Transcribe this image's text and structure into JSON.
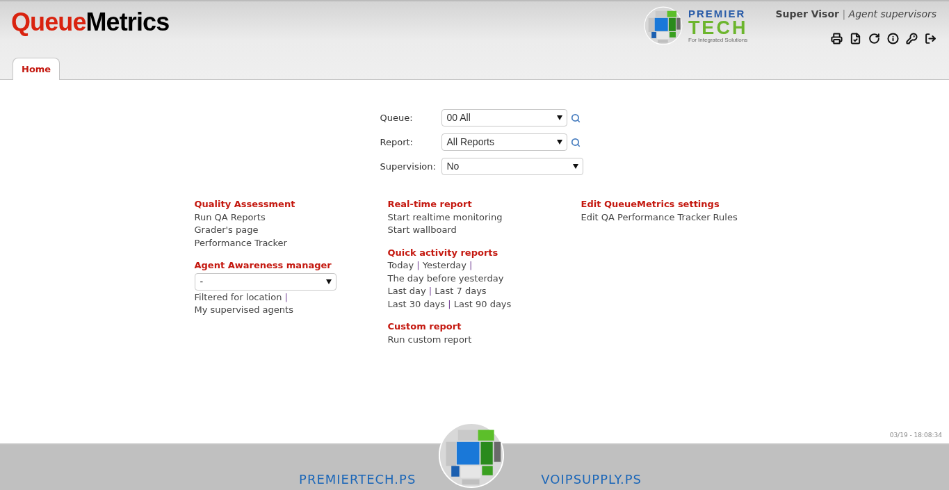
{
  "header": {
    "logo": [
      {
        "text": "Queue",
        "color": "#d9230f"
      },
      {
        "text": "Metrics",
        "color": "#000000"
      }
    ],
    "partner_logo": {
      "line_1": "PREMIER",
      "line_2": "TECH",
      "tagline": "For Integrated Solutions"
    },
    "user": {
      "name": "Super Visor",
      "separator": "|",
      "role": "Agent supervisors"
    },
    "toolbar": [
      {
        "kind": "print"
      },
      {
        "kind": "checklist"
      },
      {
        "kind": "refresh"
      },
      {
        "kind": "info"
      },
      {
        "kind": "key"
      },
      {
        "kind": "logout"
      }
    ]
  },
  "tabs": [
    {
      "label": "Home",
      "selected": true
    }
  ],
  "filters": [
    {
      "label": "Queue:",
      "value": "00 All",
      "search": true
    },
    {
      "label": "Report:",
      "value": "All Reports",
      "search": true
    },
    {
      "label": "Supervision:",
      "value": "No",
      "search": false
    }
  ],
  "separator": "|",
  "columns": [
    {
      "sections": [
        {
          "title": "Quality Assessment",
          "lines": [
            [
              "Run QA Reports"
            ],
            [
              "Grader's page"
            ],
            [
              "Performance Tracker"
            ]
          ]
        },
        {
          "title": "Agent Awareness manager",
          "select": {
            "value": "-"
          },
          "lines": [
            [
              "Filtered for location",
              "My supervised agents"
            ]
          ]
        }
      ]
    },
    {
      "sections": [
        {
          "title": "Real-time report",
          "lines": [
            [
              "Start realtime monitoring"
            ],
            [
              "Start wallboard"
            ]
          ]
        },
        {
          "title": "Quick activity reports",
          "lines": [
            [
              "Today",
              "Yesterday",
              "The day before yesterday"
            ],
            [
              "Last day",
              "Last 7 days"
            ],
            [
              "Last 30 days",
              "Last 90 days"
            ]
          ]
        },
        {
          "title": "Custom report",
          "lines": [
            [
              "Run custom report"
            ]
          ]
        }
      ]
    },
    {
      "sections": [
        {
          "title": "Edit QueueMetrics settings",
          "lines": [
            [
              "Edit QA Performance Tracker Rules"
            ]
          ]
        }
      ]
    }
  ],
  "timestamp": "03/19 - 18:08:34",
  "footer": {
    "links": [
      "PREMIERTECH.PS",
      "VOIPSUPPLY.PS"
    ]
  }
}
